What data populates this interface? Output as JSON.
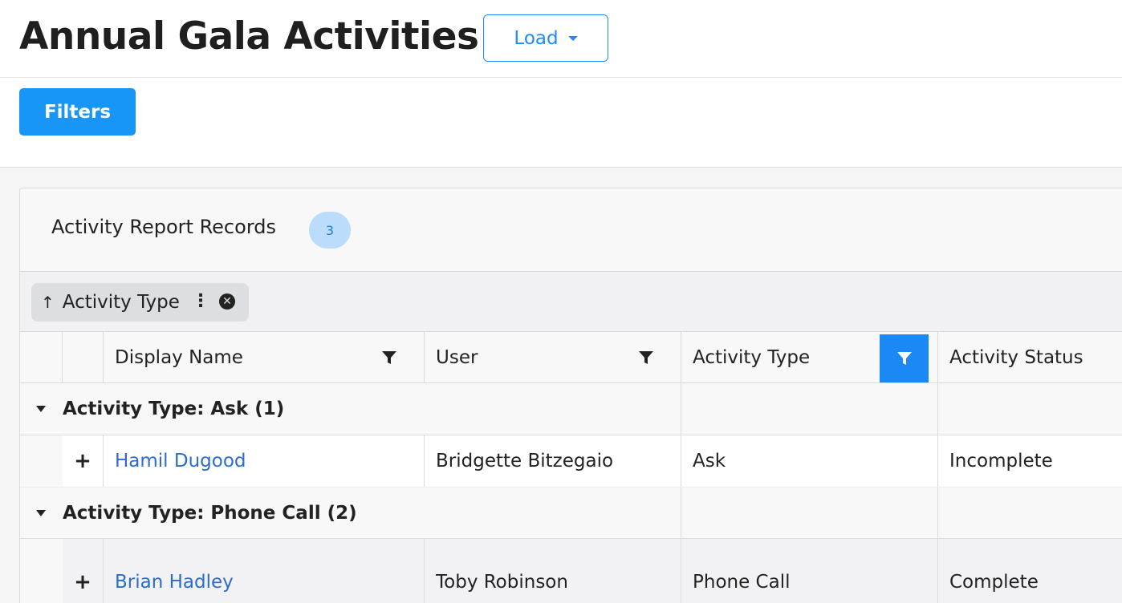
{
  "header": {
    "title": "Annual Gala Activities",
    "load_label": "Load"
  },
  "toolbar": {
    "filters_label": "Filters"
  },
  "panel": {
    "title": "Activity Report Records",
    "count": "3"
  },
  "grouping": {
    "chip_arrow": "↑",
    "chip_label": "Activity Type",
    "chip_menu": "⋮",
    "chip_remove": "✕"
  },
  "table": {
    "columns": [
      "Display Name",
      "User",
      "Activity Type",
      "Activity Status"
    ],
    "groups": [
      {
        "label": "Activity Type: Ask (1)",
        "rows": [
          {
            "expand": "+",
            "display_name": "Hamil Dugood",
            "user": "Bridgette Bitzegaio",
            "activity_type": "Ask",
            "status": "Incomplete"
          }
        ]
      },
      {
        "label": "Activity Type: Phone Call (2)",
        "rows": [
          {
            "expand": "+",
            "display_name": "Brian Hadley",
            "user": "Toby Robinson",
            "activity_type": "Phone Call",
            "status": "Complete"
          }
        ]
      }
    ]
  },
  "colors": {
    "primary": "#1896f8",
    "link": "#2b6ccc",
    "badge_bg": "#bcdcfb"
  }
}
